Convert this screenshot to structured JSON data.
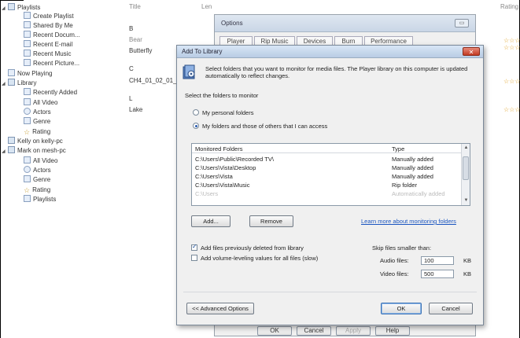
{
  "tree": {
    "items": [
      {
        "label": "Playlists",
        "level": 0,
        "toggle": "◢"
      },
      {
        "label": "Create Playlist",
        "level": 1
      },
      {
        "label": "Shared By Me",
        "level": 1
      },
      {
        "label": "Recent Docum...",
        "level": 1
      },
      {
        "label": "Recent E-mail",
        "level": 1
      },
      {
        "label": "Recent Music",
        "level": 1
      },
      {
        "label": "Recent Picture...",
        "level": 1
      },
      {
        "label": "Now Playing",
        "level": 0
      },
      {
        "label": "Library",
        "level": 0,
        "toggle": "◢"
      },
      {
        "label": "Recently Added",
        "level": 1
      },
      {
        "label": "All Video",
        "level": 1
      },
      {
        "label": "Actors",
        "level": 1
      },
      {
        "label": "Genre",
        "level": 1
      },
      {
        "label": "Rating",
        "level": 1
      },
      {
        "label": "Kelly on kelly-pc",
        "level": 0
      },
      {
        "label": "Mark on mesh-pc",
        "level": 0,
        "toggle": "◢"
      },
      {
        "label": "All Video",
        "level": 1
      },
      {
        "label": "Actors",
        "level": 1
      },
      {
        "label": "Genre",
        "level": 1
      },
      {
        "label": "Rating",
        "level": 1
      },
      {
        "label": "Playlists",
        "level": 1
      }
    ]
  },
  "list": {
    "col_title": "Title",
    "col_len": "Len",
    "col_rating": "Rating",
    "cells": [
      "B",
      "Bear",
      "Butterfly",
      "C",
      "CH4_01_02_01_449",
      "L",
      "Lake"
    ]
  },
  "options": {
    "title": "Options",
    "tabs": [
      "Player",
      "Rip Music",
      "Devices",
      "Burn",
      "Performance"
    ],
    "buttons": {
      "ok": "OK",
      "cancel": "Cancel",
      "apply": "Apply",
      "help": "Help"
    }
  },
  "dialog": {
    "title": "Add To Library",
    "close": "✕",
    "description": "Select folders that you want to monitor for media files. The Player library on this computer is updated automatically to reflect changes.",
    "select_label": "Select the folders to monitor",
    "radio_personal": "My personal folders",
    "radio_all": "My folders and those of others that I can access",
    "folders": {
      "col_folder": "Monitored Folders",
      "col_type": "Type",
      "rows": [
        {
          "path": "C:\\Users\\Public\\Recorded TV\\",
          "type": "Manually added"
        },
        {
          "path": "C:\\Users\\Vista\\Desktop",
          "type": "Manually added"
        },
        {
          "path": "C:\\Users\\Vista",
          "type": "Manually added"
        },
        {
          "path": "C:\\Users\\Vista\\Music",
          "type": "Rip folder"
        },
        {
          "path": "C:\\Users",
          "type": "Automatically added"
        }
      ]
    },
    "add_button": "Add...",
    "remove_button": "Remove",
    "learn_link": "Learn more about monitoring folders",
    "chk_deleted": "Add files previously deleted from library",
    "chk_volume": "Add volume-leveling values for all files (slow)",
    "skip_label": "Skip files smaller than:",
    "audio_label": "Audio files:",
    "audio_value": "100",
    "video_label": "Video files:",
    "video_value": "500",
    "kb": "KB",
    "advanced_button": "<< Advanced Options",
    "ok_button": "OK",
    "cancel_button": "Cancel"
  },
  "ratings": [
    "☆☆☆☆☆",
    "☆☆☆☆☆",
    "☆☆☆☆☆",
    "☆☆☆☆☆"
  ]
}
